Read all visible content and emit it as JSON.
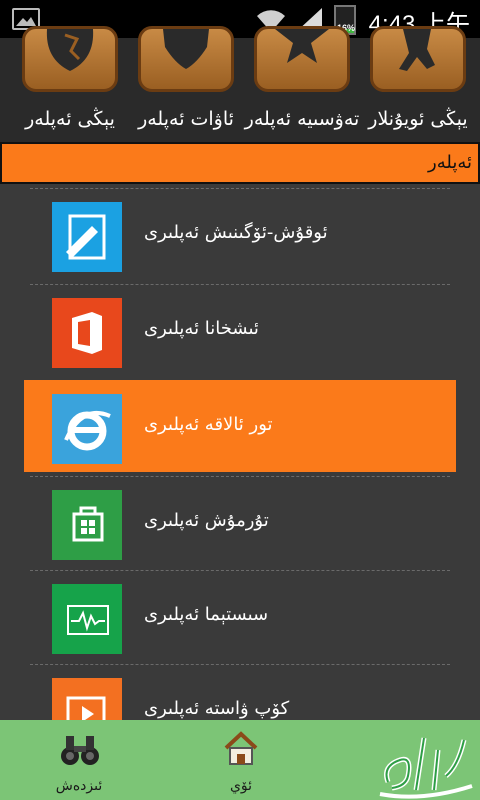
{
  "status": {
    "time": "4:43 上午",
    "battery": "16%",
    "battery_level": 0.16
  },
  "categories": [
    {
      "label": "يېڭى ئويۇنلار",
      "icon": "running-man-icon"
    },
    {
      "label": "تەۋسىيە ئەپلەر",
      "icon": "star-icon"
    },
    {
      "label": "ئاۋات ئەپلەر",
      "icon": "heart-icon"
    },
    {
      "label": "يېڭى ئەپلەر",
      "icon": "globe-icon"
    }
  ],
  "header": {
    "title": "ئەپلەر"
  },
  "items": [
    {
      "label": "ئوقۇش-ئۆگىنىش ئەپلىرى",
      "icon": "edit-document-icon",
      "color": "#1ba1e2"
    },
    {
      "label": "ئىشخانا ئەپلىرى",
      "icon": "office-icon",
      "color": "#e8481c"
    },
    {
      "label": "تور ئالاقە ئەپلىرى",
      "icon": "internet-explorer-icon",
      "color": "#3aa3dc"
    },
    {
      "label": "تۇرمۇش ئەپلىرى",
      "icon": "store-bag-icon",
      "color": "#2e9e46"
    },
    {
      "label": "سىستېما ئەپلىرى",
      "icon": "monitor-pulse-icon",
      "color": "#16a34a"
    },
    {
      "label": "كۆپ ۋاستە ئەپلىرى",
      "icon": "media-player-icon",
      "color": "#f37021"
    }
  ],
  "active_index": 2,
  "bottom": {
    "search_label": "ئىزدەش",
    "home_label": "ئۆي",
    "search_icon": "binoculars-icon",
    "home_icon": "home-icon",
    "logo_icon": "uyghur-calligraphy-logo"
  },
  "colors": {
    "accent": "#fb7a1a",
    "bottom_bar": "#7cc576",
    "background": "#3a3a3a"
  }
}
